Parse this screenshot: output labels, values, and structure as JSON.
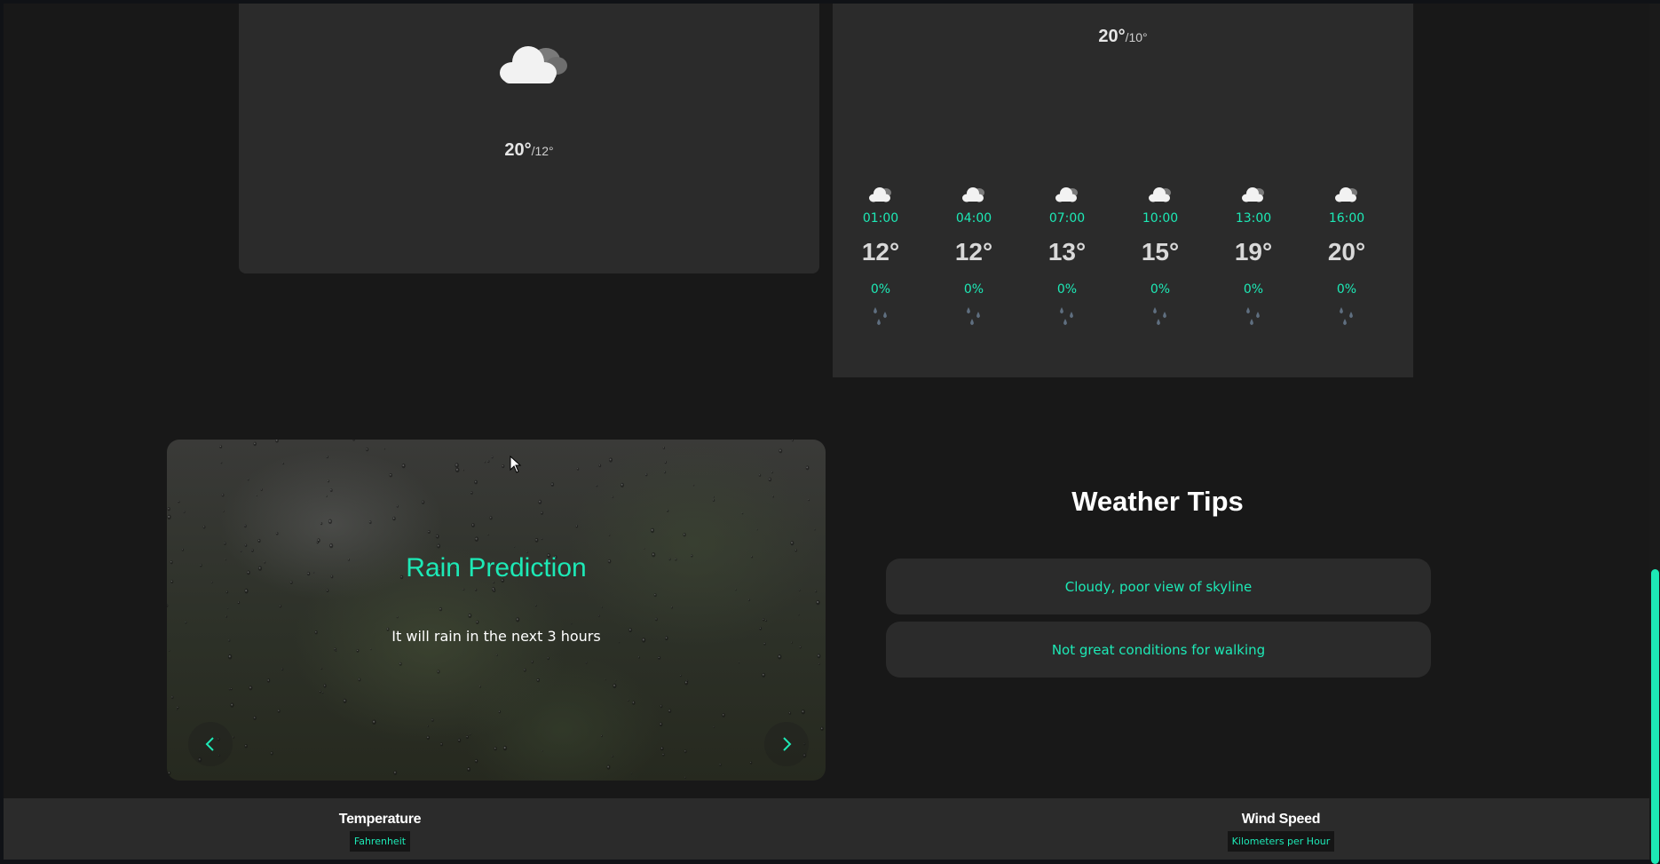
{
  "day_card": {
    "icon": "cloud-icon",
    "high": "20°",
    "low": "/12°"
  },
  "hourly_card": {
    "high": "20°",
    "low": "/10°",
    "hours": [
      {
        "time": "01:00",
        "temp": "12°",
        "precip": "0%",
        "icon": "cloud-icon"
      },
      {
        "time": "04:00",
        "temp": "12°",
        "precip": "0%",
        "icon": "cloud-icon"
      },
      {
        "time": "07:00",
        "temp": "13°",
        "precip": "0%",
        "icon": "cloud-icon"
      },
      {
        "time": "10:00",
        "temp": "15°",
        "precip": "0%",
        "icon": "cloud-icon"
      },
      {
        "time": "13:00",
        "temp": "19°",
        "precip": "0%",
        "icon": "cloud-icon"
      },
      {
        "time": "16:00",
        "temp": "20°",
        "precip": "0%",
        "icon": "cloud-icon"
      }
    ]
  },
  "carousel": {
    "title": "Rain Prediction",
    "subtitle": "It will rain in the next 3 hours",
    "prev_icon": "chevron-left-icon",
    "next_icon": "chevron-right-icon"
  },
  "tips": {
    "heading": "Weather Tips",
    "items": [
      "Cloudy, poor view of skyline",
      "Not great conditions for walking"
    ]
  },
  "footer": {
    "temperature_label": "Temperature",
    "temperature_unit": "Fahrenheit",
    "wind_label": "Wind Speed",
    "wind_unit": "Kilometers per Hour"
  },
  "colors": {
    "accent": "#1de9b6",
    "card": "#2b2b2b",
    "background": "#181818"
  }
}
